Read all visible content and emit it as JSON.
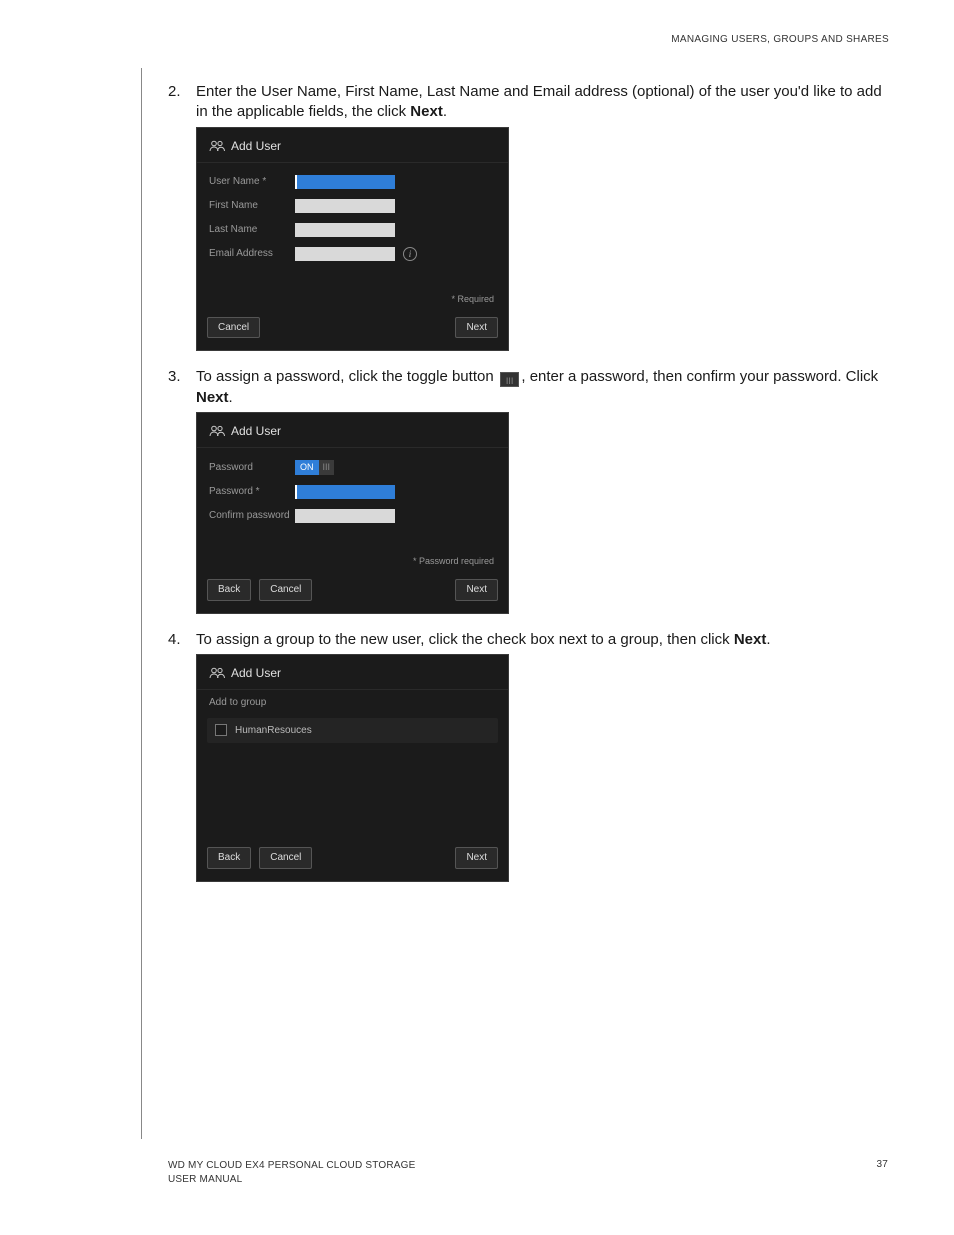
{
  "header": {
    "section": "MANAGING USERS, GROUPS AND SHARES"
  },
  "steps": {
    "s2": {
      "num": "2.",
      "text_a": "Enter the User Name, First Name, Last Name and Email address (optional) of the user you'd like to add in the applicable fields, the click ",
      "text_bold": "Next",
      "text_b": "."
    },
    "s3": {
      "num": "3.",
      "text_a": "To assign a password, click the toggle button ",
      "text_mid": ", enter a password, then confirm your password. Click ",
      "text_bold": "Next",
      "text_b": "."
    },
    "s4": {
      "num": "4.",
      "text_a": "To assign a group to the new user, click the check box next to a group, then click ",
      "text_bold": "Next",
      "text_b": "."
    }
  },
  "dlg1": {
    "title": "Add User",
    "labels": {
      "username": "User Name *",
      "first": "First Name",
      "last": "Last Name",
      "email": "Email Address"
    },
    "required": "* Required",
    "buttons": {
      "cancel": "Cancel",
      "next": "Next"
    }
  },
  "dlg2": {
    "title": "Add User",
    "labels": {
      "pwd_toggle": "Password",
      "pwd": "Password *",
      "confirm": "Confirm password"
    },
    "toggle_on": "ON",
    "toggle_handle": "III",
    "required": "* Password required",
    "buttons": {
      "back": "Back",
      "cancel": "Cancel",
      "next": "Next"
    }
  },
  "dlg3": {
    "title": "Add User",
    "subhead": "Add to group",
    "group": "HumanResouces",
    "buttons": {
      "back": "Back",
      "cancel": "Cancel",
      "next": "Next"
    }
  },
  "inline_toggle": {
    "handle": "III"
  },
  "footer": {
    "line1": "WD MY CLOUD EX4 PERSONAL CLOUD STORAGE",
    "line2": "USER MANUAL",
    "page": "37"
  }
}
